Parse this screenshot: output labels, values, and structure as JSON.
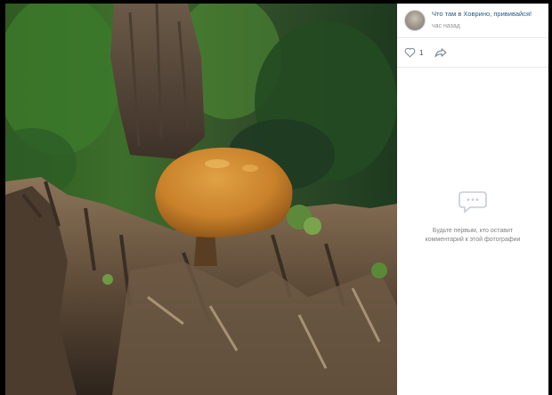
{
  "post": {
    "group_name": "Что там в Ховрино, прививайся!",
    "time": "час назад",
    "likes": "1"
  },
  "comments": {
    "empty_text": "Будьте первым, кто оставит комментарий к этой фотографии"
  },
  "icons": {
    "avatar": "group-avatar",
    "like": "heart-icon",
    "share": "share-arrow-icon",
    "comments": "speech-bubble-icon"
  },
  "colors": {
    "link": "#2a5885",
    "muted": "#939393",
    "icon": "#828a99"
  }
}
